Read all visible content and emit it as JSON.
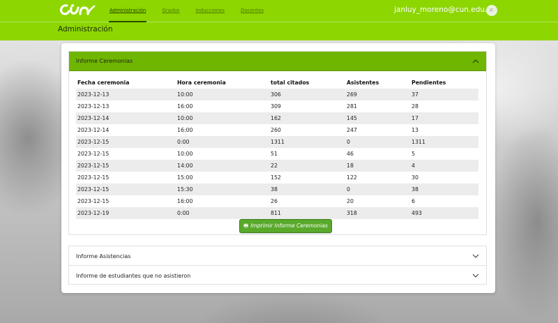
{
  "header": {
    "nav": [
      {
        "label": "Administración",
        "active": true
      },
      {
        "label": "Grados",
        "active": false
      },
      {
        "label": "Inducciones",
        "active": false
      },
      {
        "label": "Docentes",
        "active": false
      }
    ],
    "user_email": "janluy_moreno@cun.edu.co",
    "avatar_initials": "JC"
  },
  "page_title": "Administración",
  "panels": {
    "ceremonias": {
      "title": "Informe Ceremonias",
      "columns": [
        "Fecha ceremonia",
        "Hora ceremonia",
        "total citados",
        "Asistentes",
        "Pendientes"
      ],
      "rows": [
        [
          "2023-12-13",
          "10:00",
          "306",
          "269",
          "37"
        ],
        [
          "2023-12-13",
          "16:00",
          "309",
          "281",
          "28"
        ],
        [
          "2023-12-14",
          "10:00",
          "162",
          "145",
          "17"
        ],
        [
          "2023-12-14",
          "16:00",
          "260",
          "247",
          "13"
        ],
        [
          "2023-12-15",
          "0:00",
          "1311",
          "0",
          "1311"
        ],
        [
          "2023-12-15",
          "10:00",
          "51",
          "46",
          "5"
        ],
        [
          "2023-12-15",
          "14:00",
          "22",
          "18",
          "4"
        ],
        [
          "2023-12-15",
          "15:00",
          "152",
          "122",
          "30"
        ],
        [
          "2023-12-15",
          "15:30",
          "38",
          "0",
          "38"
        ],
        [
          "2023-12-15",
          "16:00",
          "26",
          "20",
          "6"
        ],
        [
          "2023-12-19",
          "0:00",
          "811",
          "318",
          "493"
        ]
      ],
      "print_label": "Imprimir Informe Ceremonias",
      "print_icon": "printer-icon"
    },
    "asistencias": {
      "title": "Informe Asistencias"
    },
    "no_asistieron": {
      "title": "Informe de estudiantes que no asistieron"
    }
  },
  "colors": {
    "brand_green": "#8dd600",
    "panel_header_green": "#6fb600",
    "button_green": "#59a92b"
  }
}
